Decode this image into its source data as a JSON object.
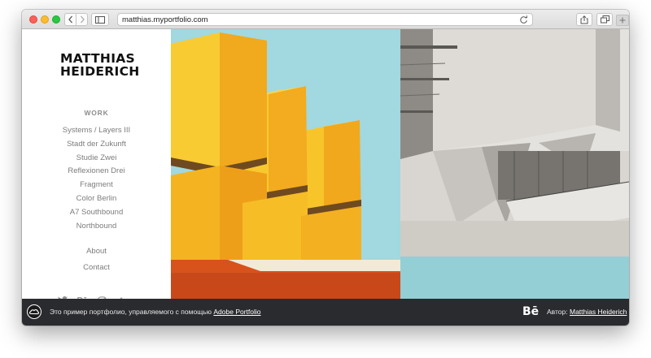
{
  "browser": {
    "url": "matthias.myportfolio.com"
  },
  "brand": {
    "line1": "MATTHIAS",
    "line2": "HEIDERICH"
  },
  "nav": {
    "heading": "WORK",
    "items": [
      "Systems / Layers III",
      "Stadt der Zukunft",
      "Studie Zwei",
      "Reflexionen Drei",
      "Fragment",
      "Color Berlin",
      "A7 Southbound",
      "Northbound"
    ],
    "about": "About",
    "contact": "Contact"
  },
  "social": {
    "icons": [
      "twitter-icon",
      "behance-icon",
      "instagram-icon",
      "tumblr-icon"
    ],
    "behance_glyph": "Bē",
    "tumblr_glyph": "t"
  },
  "promo": {
    "text": "Это пример портфолио, управляемого с помощью",
    "link": "Adobe Portfolio",
    "behance_mark": "Bē",
    "author_label": "Автор:",
    "author_link": "Matthias Heiderich"
  },
  "colors": {
    "accent_yellow": "#f5b51f",
    "orange": "#d4521c",
    "sky": "#9fd6dd",
    "footer_bg": "#2a2b2f"
  }
}
